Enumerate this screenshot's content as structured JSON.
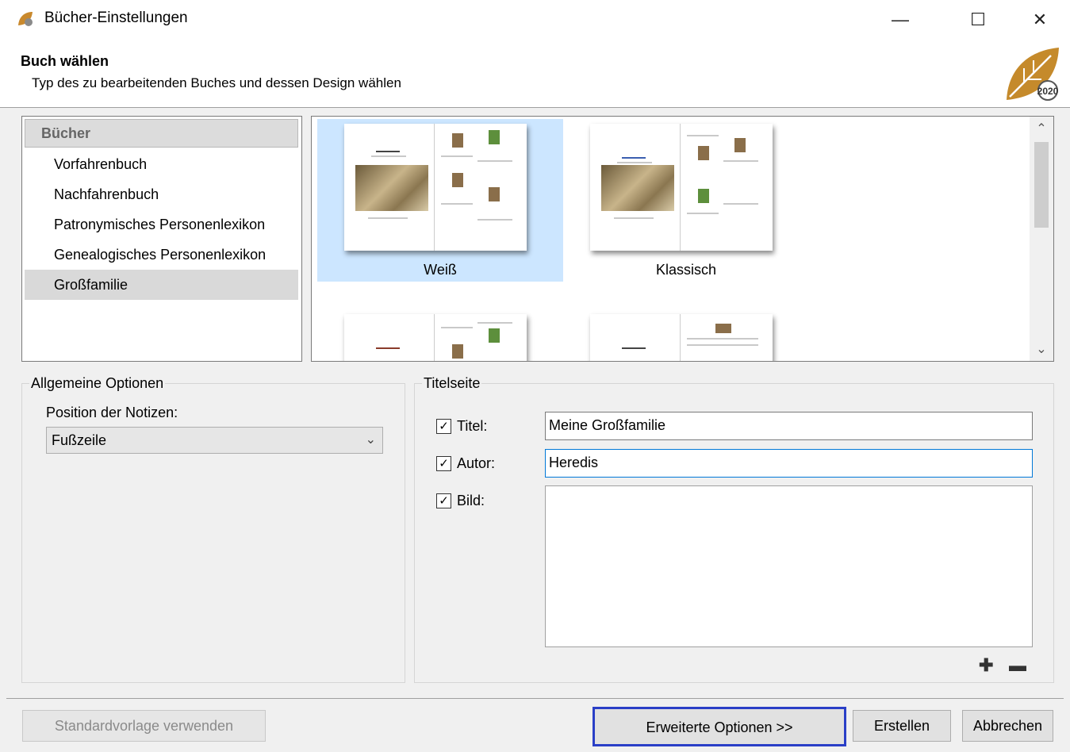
{
  "window": {
    "title": "Bücher-Einstellungen",
    "controls": {
      "minimize": "—",
      "maximize": "☐",
      "close": "✕"
    }
  },
  "header": {
    "title": "Buch wählen",
    "subtitle": "Typ des zu bearbeitenden Buches und dessen Design wählen",
    "logo_text": "2020"
  },
  "book_list": {
    "header": "Bücher",
    "items": [
      {
        "label": "Vorfahrenbuch",
        "selected": false
      },
      {
        "label": "Nachfahrenbuch",
        "selected": false
      },
      {
        "label": "Patronymisches Personenlexikon",
        "selected": false
      },
      {
        "label": "Genealogisches Personenlexikon",
        "selected": false
      },
      {
        "label": "Großfamilie",
        "selected": true
      }
    ]
  },
  "designs": {
    "items": [
      {
        "label": "Weiß",
        "selected": true
      },
      {
        "label": "Klassisch",
        "selected": false
      },
      {
        "label": "",
        "selected": false
      },
      {
        "label": "",
        "selected": false
      }
    ]
  },
  "general_options": {
    "group_label": "Allgemeine Optionen",
    "notes_label": "Position der Notizen:",
    "notes_value": "Fußzeile"
  },
  "title_page": {
    "group_label": "Titelseite",
    "title": {
      "label": "Titel:",
      "checked": true,
      "value": "Meine Großfamilie"
    },
    "author": {
      "label": "Autor:",
      "checked": true,
      "value": "Heredis"
    },
    "image": {
      "label": "Bild:",
      "checked": true
    }
  },
  "footer": {
    "default_template": "Standardvorlage verwenden",
    "advanced": "Erweiterte Optionen >>",
    "create": "Erstellen",
    "cancel": "Abbrechen"
  },
  "colors": {
    "selection": "#cce6ff",
    "highlight_border": "#2a3fc7",
    "focus_border": "#0078d7"
  }
}
